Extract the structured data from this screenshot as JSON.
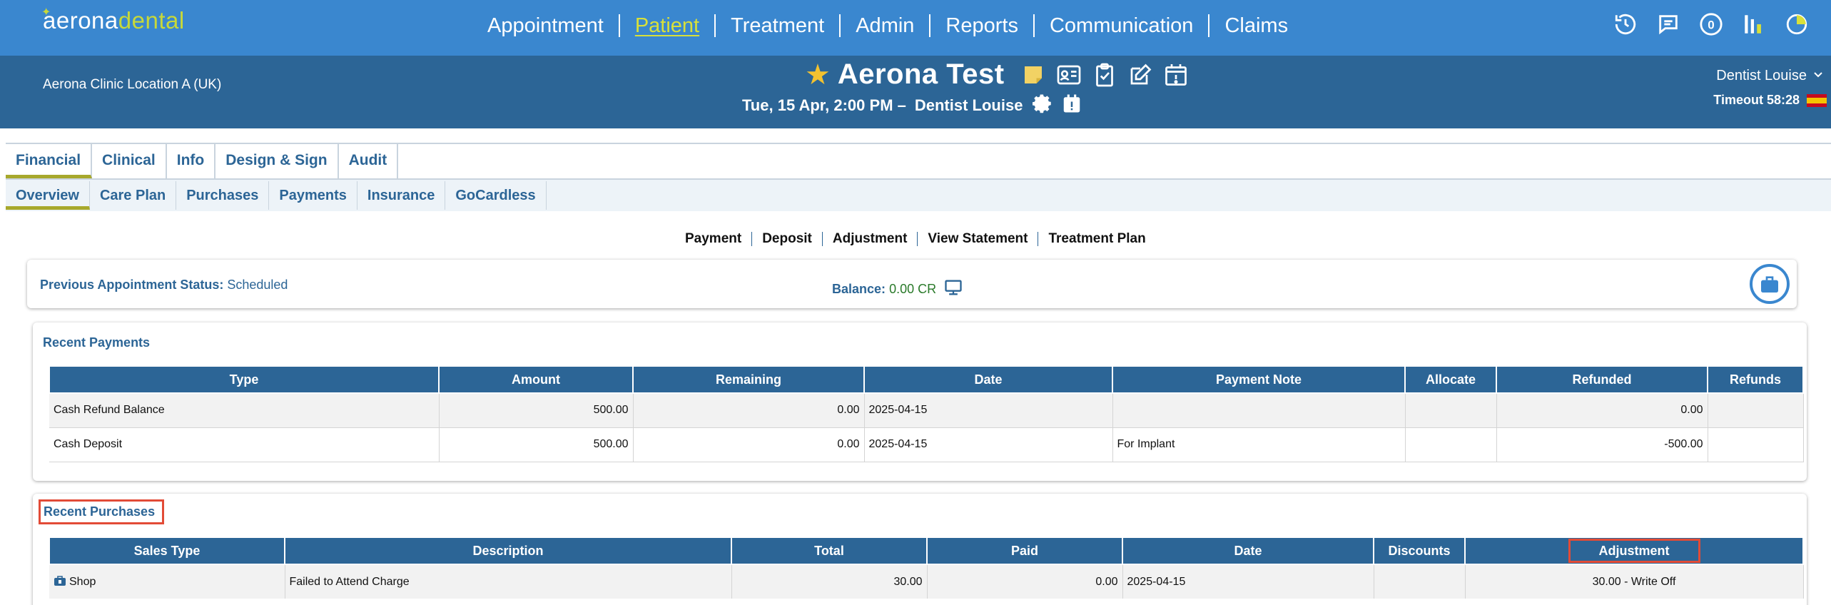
{
  "nav": {
    "logo_part1": "aerona",
    "logo_part2": "dental",
    "items": [
      {
        "label": "Appointment",
        "active": false
      },
      {
        "label": "Patient",
        "active": true
      },
      {
        "label": "Treatment",
        "active": false
      },
      {
        "label": "Admin",
        "active": false
      },
      {
        "label": "Reports",
        "active": false
      },
      {
        "label": "Communication",
        "active": false
      },
      {
        "label": "Claims",
        "active": false
      }
    ],
    "notification_count": "0",
    "icons": [
      "history-icon",
      "chat-icon",
      "notification-count-icon",
      "reports-bars-icon",
      "pie-chart-icon"
    ]
  },
  "patient_header": {
    "clinic": "Aerona Clinic Location A (UK)",
    "patient_name": "Aerona Test",
    "appointment": "Tue, 15 Apr, 2:00 PM –",
    "appointment_dentist": "Dentist Louise",
    "user": "Dentist Louise",
    "timeout": "Timeout 58:28"
  },
  "tabs": [
    {
      "label": "Financial",
      "active": true
    },
    {
      "label": "Clinical",
      "active": false
    },
    {
      "label": "Info",
      "active": false
    },
    {
      "label": "Design & Sign",
      "active": false
    },
    {
      "label": "Audit",
      "active": false
    }
  ],
  "subtabs": [
    {
      "label": "Overview",
      "active": true
    },
    {
      "label": "Care Plan",
      "active": false
    },
    {
      "label": "Purchases",
      "active": false
    },
    {
      "label": "Payments",
      "active": false
    },
    {
      "label": "Insurance",
      "active": false
    },
    {
      "label": "GoCardless",
      "active": false
    }
  ],
  "actions": [
    "Payment",
    "Deposit",
    "Adjustment",
    "View Statement",
    "Treatment Plan"
  ],
  "status": {
    "prev_label": "Previous Appointment Status:",
    "prev_value": "Scheduled",
    "balance_label": "Balance:",
    "balance_value": "0.00 CR"
  },
  "recent_payments": {
    "title": "Recent Payments",
    "columns": [
      "Type",
      "Amount",
      "Remaining",
      "Date",
      "Payment Note",
      "Allocate",
      "Refunded",
      "Refunds"
    ],
    "rows": [
      [
        "Cash Refund Balance",
        "500.00",
        "0.00",
        "2025-04-15",
        "",
        "",
        "0.00",
        ""
      ],
      [
        "Cash Deposit",
        "500.00",
        "0.00",
        "2025-04-15",
        "For Implant",
        "",
        "-500.00",
        ""
      ]
    ]
  },
  "recent_purchases": {
    "title": "Recent Purchases",
    "columns": [
      "Sales Type",
      "Description",
      "Total",
      "Paid",
      "Date",
      "Discounts",
      "Adjustment"
    ],
    "rows": [
      [
        "Shop",
        "Failed to Attend Charge",
        "30.00",
        "0.00",
        "2025-04-15",
        "",
        "30.00 - Write Off"
      ]
    ]
  },
  "colors": {
    "nav_bg": "#3a87cf",
    "header_bg": "#2c6596",
    "accent": "#d8e03a",
    "highlight_box": "#e24b37"
  }
}
